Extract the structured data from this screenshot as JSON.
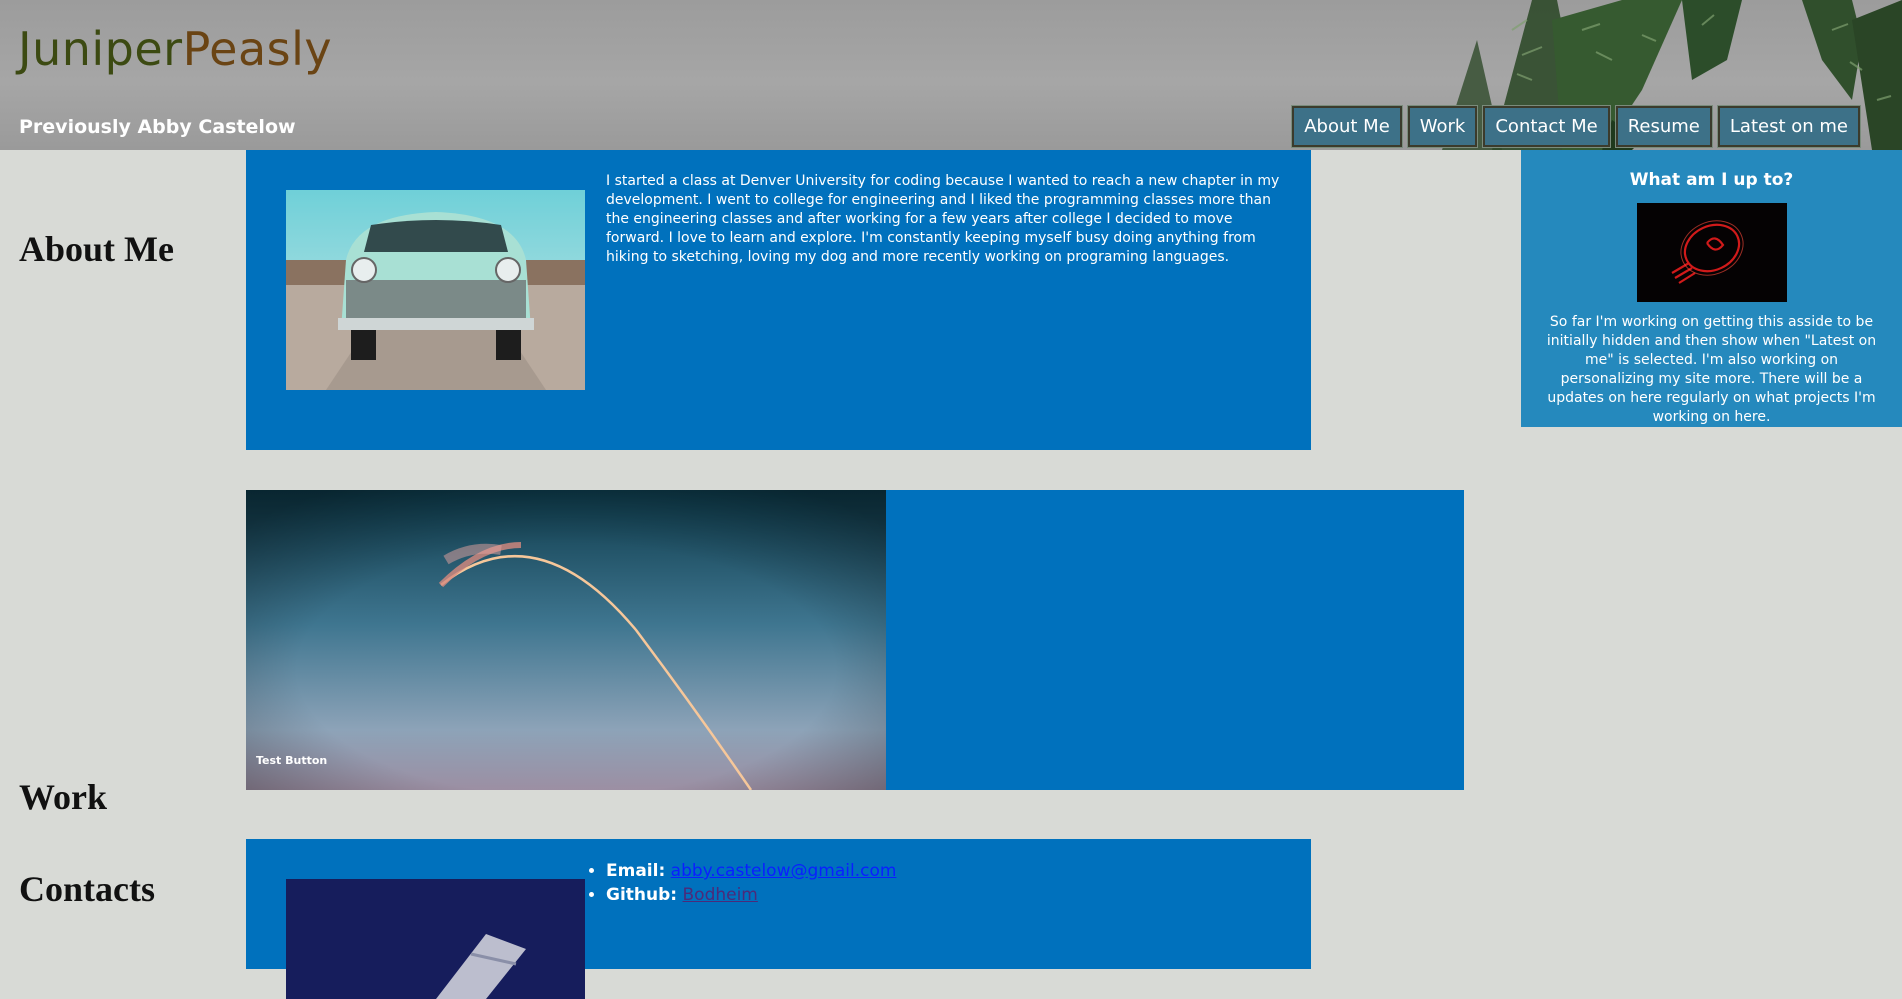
{
  "header": {
    "logo_part1": "Juniper",
    "logo_part2": "Peasly",
    "tagline": "Previously Abby Castelow",
    "nav": [
      "About Me",
      "Work",
      "Contact Me",
      "Resume",
      "Latest on me"
    ]
  },
  "sections": {
    "about_heading": "About Me",
    "work_heading": "Work",
    "contacts_heading": "Contacts"
  },
  "about": {
    "text": "I started a class at Denver University for coding because I wanted to reach a new chapter in my development. I went to college for engineering and I liked the programming classes more than the engineering classes and after working for a few years after college I decided to move forward. I love to learn and explore. I'm constantly keeping myself busy doing anything from hiking to sketching, loving my dog and more recently working on programing languages."
  },
  "work": {
    "button_label": "Test Button"
  },
  "contact": {
    "email_label": "Email:",
    "email_value": "abby.castelow@gmail.com",
    "github_label": "Github:",
    "github_value": "Bodheim"
  },
  "aside": {
    "title": "What am I up to?",
    "text": "So far I'm working on getting this asside to be initially hidden and then show when \"Latest on me\" is selected. I'm also working on personalizing my site more. There will be a updates on here regularly on what projects I'm working on here."
  },
  "colors": {
    "panel": "#0071bd",
    "aside": "#2589bd",
    "nav_button": "#3d7188",
    "page_bg": "#d8dad6"
  }
}
